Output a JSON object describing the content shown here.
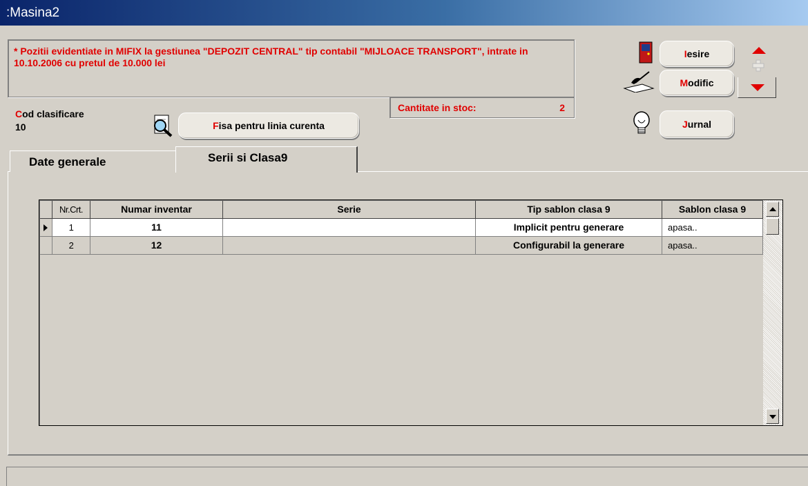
{
  "window": {
    "title": ":Masina2"
  },
  "info": {
    "message": "* Pozitii evidentiate in MIFIX la gestiunea \"DEPOZIT CENTRAL\" tip contabil \"MIJLOACE TRANSPORT\", intrate in 10.10.2006 cu pretul de 10.000 lei"
  },
  "stock": {
    "label": "Cantitate in stoc:",
    "value": "2"
  },
  "cod": {
    "label_first": "C",
    "label_rest": "od clasificare",
    "value": "10"
  },
  "buttons": {
    "fisa": {
      "first": "F",
      "rest": "isa pentru linia curenta"
    },
    "iesire": {
      "first": "I",
      "rest": "esire"
    },
    "modific": {
      "first": "M",
      "rest": "odific"
    },
    "jurnal": {
      "first": "J",
      "rest": "urnal"
    }
  },
  "tabs": [
    {
      "label": "Date generale",
      "active": false
    },
    {
      "label": "Serii si Clasa9",
      "active": true
    }
  ],
  "grid": {
    "columns": [
      "Nr.Crt.",
      "Numar inventar",
      "Serie",
      "Tip sablon clasa 9",
      "Sablon clasa 9"
    ],
    "rows": [
      {
        "nr": "1",
        "inventar": "11",
        "serie": "",
        "tip": "Implicit pentru generare",
        "sablon": "apasa.."
      },
      {
        "nr": "2",
        "inventar": "12",
        "serie": "",
        "tip": "Configurabil la generare",
        "sablon": "apasa.."
      }
    ]
  },
  "colors": {
    "accent_red": "#e00000",
    "title_bar": "#0a246a",
    "face": "#d4d0c8"
  },
  "icons": [
    "door-exit-icon",
    "pen-edit-icon",
    "magnifier-document-icon",
    "lightbulb-icon",
    "arrow-up-icon",
    "arrow-down-icon",
    "move-cross-icon"
  ]
}
